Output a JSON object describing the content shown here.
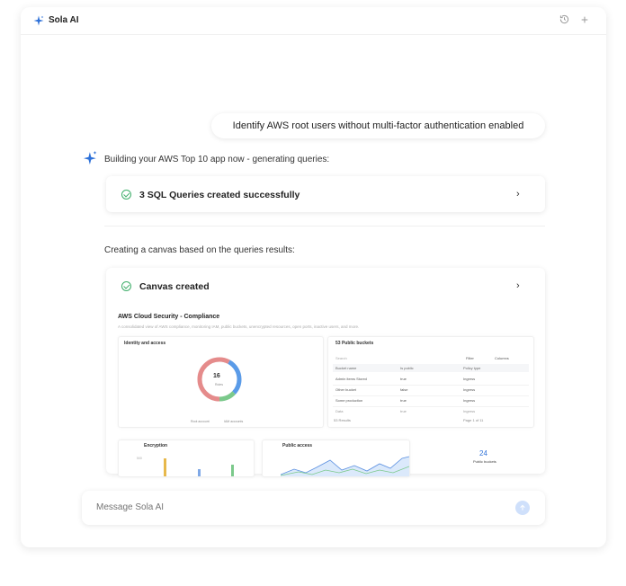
{
  "app": {
    "name": "Sola AI"
  },
  "titlebar": {
    "history_icon": "history-icon",
    "new_icon": "plus-icon"
  },
  "conversation": {
    "user_message": "Identify AWS root users without multi-factor authentication enabled",
    "assistant_intro": "Building your AWS Top 10 app now - generating queries:",
    "queries_card": {
      "title": "3 SQL Queries created successfully"
    },
    "canvas_intro": "Creating a canvas based on the queries results:",
    "canvas_card": {
      "title": "Canvas created"
    }
  },
  "canvas_preview": {
    "title": "AWS Cloud Security - Compliance",
    "subtitle": "A consolidated view of AWS compliance, monitoring IAM, public buckets, unencrypted resources, open ports, inactive users, and more.",
    "identity_panel": {
      "label": "Identity and access",
      "donut_value": "16",
      "donut_caption": "Roles",
      "legend": [
        "Root account",
        "IAM accounts"
      ]
    },
    "buckets_panel": {
      "label": "53 Public buckets",
      "search_placeholder": "Search",
      "filter_label": "Filter",
      "columns_label": "Columns",
      "headers": [
        "Bucket name",
        "Is public",
        "Policy type"
      ],
      "rows": [
        [
          "Admin items Stored",
          "true",
          "Ingress"
        ],
        [
          "Other bucket",
          "false",
          "Ingress"
        ],
        [
          "Some production",
          "true",
          "Ingress"
        ],
        [
          "Data",
          "true",
          "Ingress"
        ]
      ],
      "footer_left": "53 Results",
      "footer_right": "Page 1 of 11"
    },
    "encryption_panel": {
      "label": "Encryption",
      "axis": "500"
    },
    "public_access_panel": {
      "label": "Public access"
    },
    "public_buckets_stat": {
      "value": "24",
      "caption": "Public buckets"
    }
  },
  "composer": {
    "placeholder": "Message Sola AI"
  },
  "colors": {
    "accent": "#3b7be0",
    "success": "#3fae6a"
  }
}
